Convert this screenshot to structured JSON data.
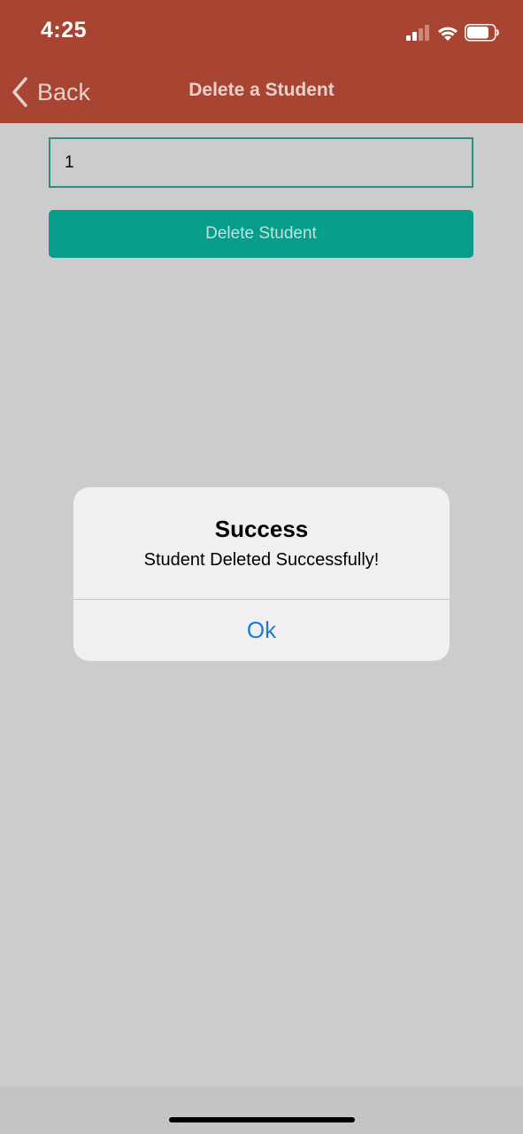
{
  "status_bar": {
    "time": "4:25",
    "icons": [
      "cellular-signal-icon",
      "wifi-icon",
      "battery-icon"
    ]
  },
  "nav": {
    "back_label": "Back",
    "back_icon": "chevron-left-icon",
    "title": "Delete a Student"
  },
  "form": {
    "student_id_value": "1",
    "delete_button_label": "Delete Student"
  },
  "alert": {
    "title": "Success",
    "message": "Student Deleted Successfully!",
    "ok_label": "Ok"
  },
  "colors": {
    "header_background": "#a84432",
    "content_background": "#cccccc",
    "accent_teal": "#069e8a",
    "alert_background": "#f0f0f0",
    "alert_link_blue": "#1a7ae0"
  }
}
